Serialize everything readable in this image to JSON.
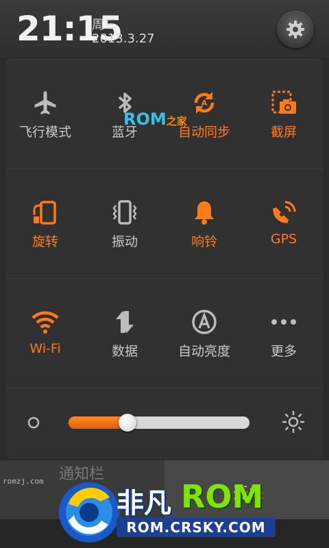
{
  "status": {
    "time": "21:15",
    "weekday": "周三",
    "date": "2013.3.27"
  },
  "toggles": [
    {
      "label": "飞行模式",
      "icon": "airplane-icon",
      "on": false
    },
    {
      "label": "蓝牙",
      "icon": "bluetooth-icon",
      "on": false
    },
    {
      "label": "自动同步",
      "icon": "sync-icon",
      "on": true
    },
    {
      "label": "截屏",
      "icon": "screenshot-icon",
      "on": true
    },
    {
      "label": "旋转",
      "icon": "rotate-icon",
      "on": true
    },
    {
      "label": "振动",
      "icon": "vibrate-icon",
      "on": false
    },
    {
      "label": "响铃",
      "icon": "bell-icon",
      "on": true
    },
    {
      "label": "GPS",
      "icon": "gps-icon",
      "on": true
    },
    {
      "label": "Wi-Fi",
      "icon": "wifi-icon",
      "on": true
    },
    {
      "label": "数据",
      "icon": "data-icon",
      "on": false
    },
    {
      "label": "自动亮度",
      "icon": "auto-brightness-icon",
      "on": false
    },
    {
      "label": "更多",
      "icon": "more-icon",
      "on": false
    }
  ],
  "brightness": {
    "level": 0.32
  },
  "colors": {
    "accent": "#ff7a1a",
    "inactive": "#c9c9c9",
    "panel": "#313131"
  },
  "bottom_tabs": {
    "left": "通知栏",
    "right": "开关"
  },
  "watermark": {
    "small_url": "romzj.com",
    "mid_rom": "ROM",
    "mid_suffix": "之家",
    "brand_cn": "非凡",
    "brand_rom": "ROM",
    "brand_url": "ROM.CRSKY.COM"
  }
}
